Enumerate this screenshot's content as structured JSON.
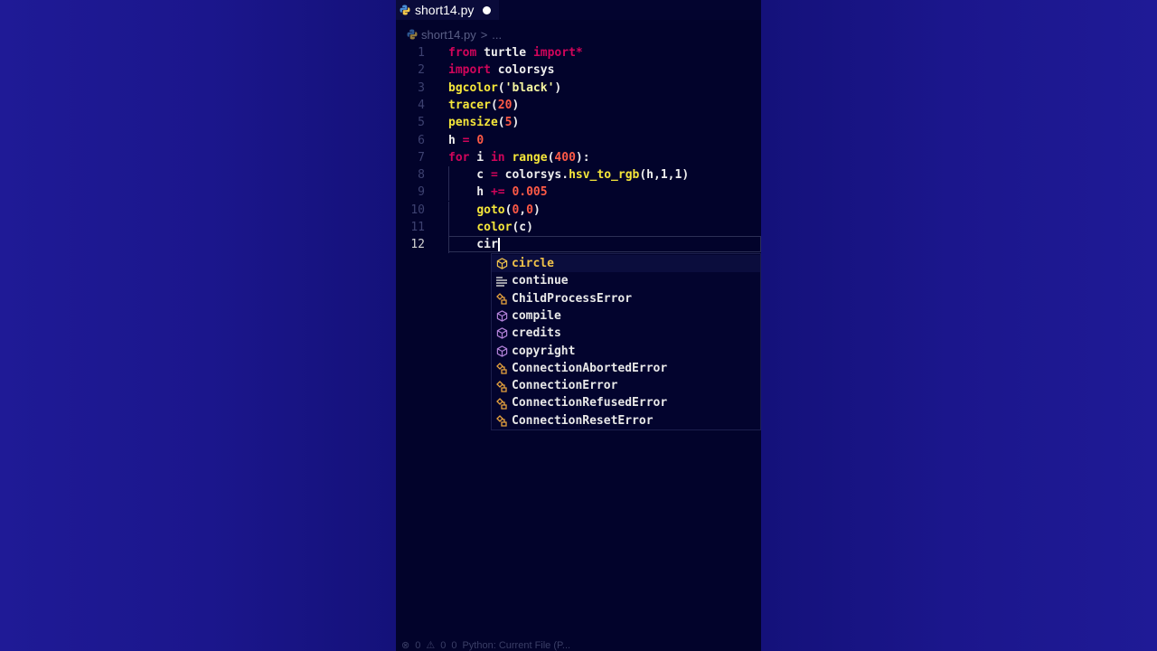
{
  "tab": {
    "filename": "short14.py"
  },
  "breadcrumb": {
    "file": "short14.py",
    "separator": ">",
    "rest": "..."
  },
  "code_lines": [
    {
      "num": "1",
      "tokens": [
        [
          "kw",
          "from"
        ],
        [
          "id",
          " turtle "
        ],
        [
          "kw",
          "import*"
        ]
      ]
    },
    {
      "num": "2",
      "tokens": [
        [
          "kw",
          "import"
        ],
        [
          "id",
          " colorsys"
        ]
      ]
    },
    {
      "num": "3",
      "tokens": [
        [
          "fn",
          "bgcolor"
        ],
        [
          "punc",
          "("
        ],
        [
          "str",
          "'black'"
        ],
        [
          "punc",
          ")"
        ]
      ]
    },
    {
      "num": "4",
      "tokens": [
        [
          "fn",
          "tracer"
        ],
        [
          "punc",
          "("
        ],
        [
          "num",
          "20"
        ],
        [
          "punc",
          ")"
        ]
      ]
    },
    {
      "num": "5",
      "tokens": [
        [
          "fn",
          "pensize"
        ],
        [
          "punc",
          "("
        ],
        [
          "num",
          "5"
        ],
        [
          "punc",
          ")"
        ]
      ]
    },
    {
      "num": "6",
      "tokens": [
        [
          "id",
          "h "
        ],
        [
          "op",
          "="
        ],
        [
          "id",
          " "
        ],
        [
          "num",
          "0"
        ]
      ]
    },
    {
      "num": "7",
      "tokens": [
        [
          "kw",
          "for"
        ],
        [
          "id",
          " i "
        ],
        [
          "kw",
          "in"
        ],
        [
          "id",
          " "
        ],
        [
          "fn",
          "range"
        ],
        [
          "punc",
          "("
        ],
        [
          "num",
          "400"
        ],
        [
          "punc",
          "):"
        ]
      ]
    },
    {
      "num": "8",
      "tokens": [
        [
          "id",
          "    c "
        ],
        [
          "op",
          "="
        ],
        [
          "id",
          " colorsys."
        ],
        [
          "attr",
          "hsv_to_rgb"
        ],
        [
          "punc",
          "(h,1,1)"
        ]
      ]
    },
    {
      "num": "9",
      "tokens": [
        [
          "id",
          "    h "
        ],
        [
          "op",
          "+="
        ],
        [
          "id",
          " "
        ],
        [
          "num",
          "0.005"
        ]
      ]
    },
    {
      "num": "10",
      "tokens": [
        [
          "id",
          "    "
        ],
        [
          "fn",
          "goto"
        ],
        [
          "punc",
          "("
        ],
        [
          "num",
          "0"
        ],
        [
          "punc",
          ","
        ],
        [
          "num",
          "0"
        ],
        [
          "punc",
          ")"
        ]
      ]
    },
    {
      "num": "11",
      "tokens": [
        [
          "id",
          "    "
        ],
        [
          "fn",
          "color"
        ],
        [
          "punc",
          "(c)"
        ]
      ]
    },
    {
      "num": "12",
      "tokens": [
        [
          "id",
          "    cir"
        ]
      ]
    }
  ],
  "suggestions": [
    {
      "label": "circle",
      "icon": "cube-icon",
      "color": "#f0c24a",
      "selected": true
    },
    {
      "label": "continue",
      "icon": "keyword-icon",
      "color": "#cccccc",
      "selected": false
    },
    {
      "label": "ChildProcessError",
      "icon": "class-icon",
      "color": "#e8a33d",
      "selected": false
    },
    {
      "label": "compile",
      "icon": "cube-icon",
      "color": "#b180d7",
      "selected": false
    },
    {
      "label": "credits",
      "icon": "cube-icon",
      "color": "#b180d7",
      "selected": false
    },
    {
      "label": "copyright",
      "icon": "cube-icon",
      "color": "#b180d7",
      "selected": false
    },
    {
      "label": "ConnectionAbortedError",
      "icon": "class-icon",
      "color": "#e8a33d",
      "selected": false
    },
    {
      "label": "ConnectionError",
      "icon": "class-icon",
      "color": "#e8a33d",
      "selected": false
    },
    {
      "label": "ConnectionRefusedError",
      "icon": "class-icon",
      "color": "#e8a33d",
      "selected": false
    },
    {
      "label": "ConnectionResetError",
      "icon": "class-icon",
      "color": "#e8a33d",
      "selected": false
    }
  ],
  "statusbar": {
    "errors": "0",
    "warnings": "0",
    "problems": "0",
    "run_config": "Python: Current File (P..."
  }
}
